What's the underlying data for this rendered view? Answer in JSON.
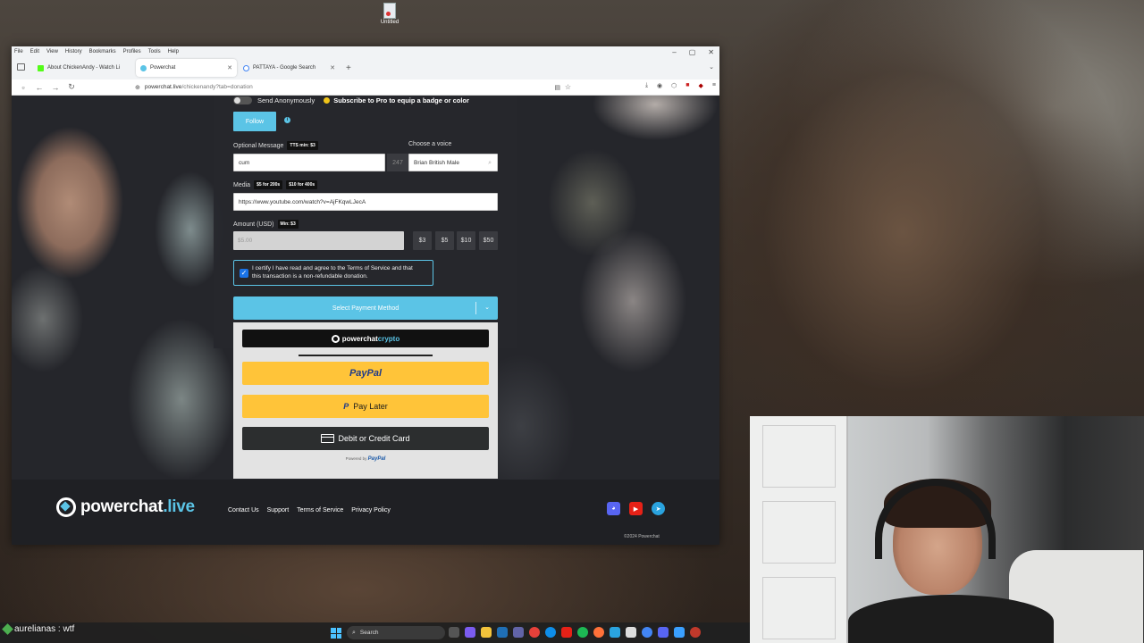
{
  "desktop": {
    "icon_label": "Untitled"
  },
  "browser": {
    "menu": [
      "File",
      "Edit",
      "View",
      "History",
      "Bookmarks",
      "Profiles",
      "Tools",
      "Help"
    ],
    "tabs": [
      {
        "label": "About ChickenAndy - Watch Li",
        "favicon_color": "#53fc18",
        "active": false
      },
      {
        "label": "Powerchat",
        "favicon_color": "#5bc4e6",
        "active": true
      },
      {
        "label": "PATTAYA - Google Search",
        "favicon_color": "#4285f4",
        "active": false
      }
    ],
    "url_host": "powerchat.live",
    "url_path": "/chickenandy?tab=donation"
  },
  "form": {
    "send_anonymously": "Send Anonymously",
    "pro_note": "Subscribe to Pro to equip a badge or color",
    "follow": "Follow",
    "optional_message_label": "Optional Message",
    "tts_badge": "TTS min: $3",
    "message_value": "cum",
    "char_remaining": "247",
    "voice_label": "Choose a voice",
    "voice_value": "Brian British Male",
    "media_label": "Media",
    "media_badge_1": "$5 for 200s",
    "media_badge_2": "$10 for 400s",
    "media_value": "https://www.youtube.com/watch?v=AjFKqwLJecA",
    "amount_label": "Amount (USD)",
    "amount_badge": "Min: $3",
    "amount_placeholder": "$5.00",
    "presets": [
      "$3",
      "$5",
      "$10",
      "$50"
    ],
    "certify_text": "I certify I have read and agree to the Terms of Service and that this transaction is a non-refundable donation.",
    "certify_checked": true,
    "payment_method": "Select Payment Method"
  },
  "payment": {
    "crypto_brand": "powerchat",
    "crypto_accent": "crypto",
    "paypal": "PayPal",
    "pay_later": "Pay Later",
    "card": "Debit or Credit Card",
    "powered_by": "Powered by",
    "powered_brand": "PayPal"
  },
  "footer": {
    "logo_main": "powerchat",
    "logo_accent": ".live",
    "links": [
      "Contact Us",
      "Support",
      "Terms of Service",
      "Privacy Policy"
    ],
    "copyright": "©2024 Powerchat"
  },
  "taskbar": {
    "chat_overlay": "aurelianas : wtf",
    "search_placeholder": "Search"
  },
  "colors": {
    "accent": "#5bc4e6",
    "paypal_yellow": "#ffc439",
    "card_dark": "#2c2e2f"
  }
}
